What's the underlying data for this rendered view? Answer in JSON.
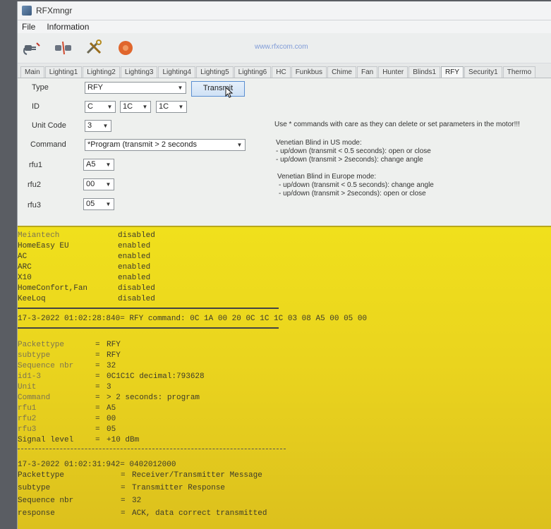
{
  "window": {
    "title": "RFXmngr"
  },
  "menu": [
    "File",
    "Information"
  ],
  "toolbar": {
    "url_text": "www.rfxcom.com"
  },
  "tabs": [
    "Main",
    "Lighting1",
    "Lighting2",
    "Lighting3",
    "Lighting4",
    "Lighting5",
    "Lighting6",
    "HC",
    "Funkbus",
    "Chime",
    "Fan",
    "Hunter",
    "Blinds1",
    "RFY",
    "Security1",
    "Thermo"
  ],
  "active_tab": "RFY",
  "form": {
    "type_label": "Type",
    "type_value": "RFY",
    "transmit_label": "Transmit",
    "id_label": "ID",
    "id1": "C",
    "id2": "1C",
    "id3": "1C",
    "unitcode_label": "Unit Code",
    "unitcode_value": "3",
    "command_label": "Command",
    "command_value": "*Program (transmit > 2 seconds",
    "rfu1_label": "rfu1",
    "rfu1_value": "A5",
    "rfu2_label": "rfu2",
    "rfu2_value": "00",
    "rfu3_label": "rfu3",
    "rfu3_value": "05"
  },
  "notes": {
    "warning": "Use * commands with care as they can delete or set parameters in the motor!!!",
    "us_title": "Venetian Blind in US mode:",
    "us_line1": "- up/down (transmit < 0.5 seconds): open or close",
    "us_line2": "- up/down (transmit > 2seconds): change angle",
    "eu_title": "Venetian Blind in Europe mode:",
    "eu_line1": "- up/down (transmit < 0.5 seconds): change angle",
    "eu_line2": "- up/down (transmit > 2seconds): open or close"
  },
  "log": {
    "protocols": [
      {
        "name": "Meiantech",
        "state": "disabled"
      },
      {
        "name": "HomeEasy EU",
        "state": "enabled"
      },
      {
        "name": "AC",
        "state": "enabled"
      },
      {
        "name": "ARC",
        "state": "enabled"
      },
      {
        "name": "X10",
        "state": "enabled"
      },
      {
        "name": "HomeConfort,Fan",
        "state": "disabled"
      },
      {
        "name": "KeeLoq",
        "state": "disabled"
      }
    ],
    "cmd_header": "17-3-2022 01:02:28:840= RFY command: 0C 1A 00 20 0C 1C 1C 03 08 A5 00 05 00",
    "packet_fields": [
      {
        "key": "Packettype",
        "value": "RFY"
      },
      {
        "key": "subtype",
        "value": "RFY"
      },
      {
        "key": "Sequence nbr",
        "value": "32"
      },
      {
        "key": "id1-3",
        "value": "0C1C1C decimal:793628"
      },
      {
        "key": "Unit",
        "value": "3"
      },
      {
        "key": "Command",
        "value": "> 2 seconds: program"
      },
      {
        "key": "rfu1",
        "value": "A5"
      },
      {
        "key": "rfu2",
        "value": "00"
      },
      {
        "key": "rfu3",
        "value": "05"
      },
      {
        "key": "Signal level",
        "value": "+10 dBm"
      }
    ],
    "resp_header": "17-3-2022 01:02:31:942= 0402012000",
    "resp_fields": [
      {
        "key": "Packettype",
        "value": "Receiver/Transmitter Message"
      },
      {
        "key": "subtype",
        "value": "Transmitter Response"
      },
      {
        "key": "Sequence nbr",
        "value": "32"
      },
      {
        "key": "response",
        "value": "ACK, data correct transmitted"
      }
    ],
    "eq": "="
  }
}
